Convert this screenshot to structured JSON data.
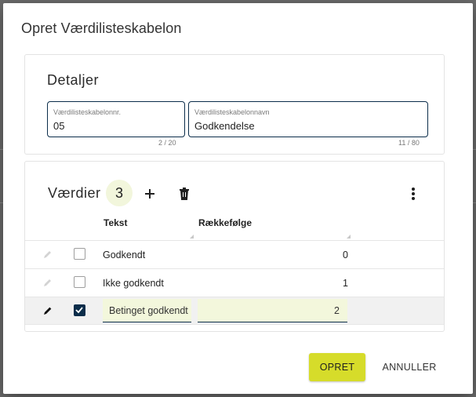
{
  "dialog": {
    "title": "Opret Værdilisteskabelon"
  },
  "details": {
    "title": "Detaljer",
    "number_field": {
      "label": "Værdilisteskabelonnr.",
      "value": "05",
      "counter": "2 / 20"
    },
    "name_field": {
      "label": "Værdilisteskabelonnavn",
      "value": "Godkendelse",
      "counter": "11 / 80"
    }
  },
  "values": {
    "title": "Værdier",
    "count": "3",
    "icons": {
      "add": "plus-icon",
      "delete": "trash-icon",
      "more": "more-vert-icon"
    },
    "columns": {
      "text": "Tekst",
      "order": "Rækkefølge"
    },
    "rows": [
      {
        "text": "Godkendt",
        "order": "0",
        "checked": false
      },
      {
        "text": "Ikke godkendt",
        "order": "1",
        "checked": false
      },
      {
        "text": "Betinget godkendt",
        "order": "2",
        "checked": true
      }
    ]
  },
  "actions": {
    "create": "OPRET",
    "cancel": "ANNULLER"
  },
  "colors": {
    "accent": "#d6dc2a",
    "primary_dark": "#0b2d4a",
    "badge_bg": "#f2f6dc"
  }
}
